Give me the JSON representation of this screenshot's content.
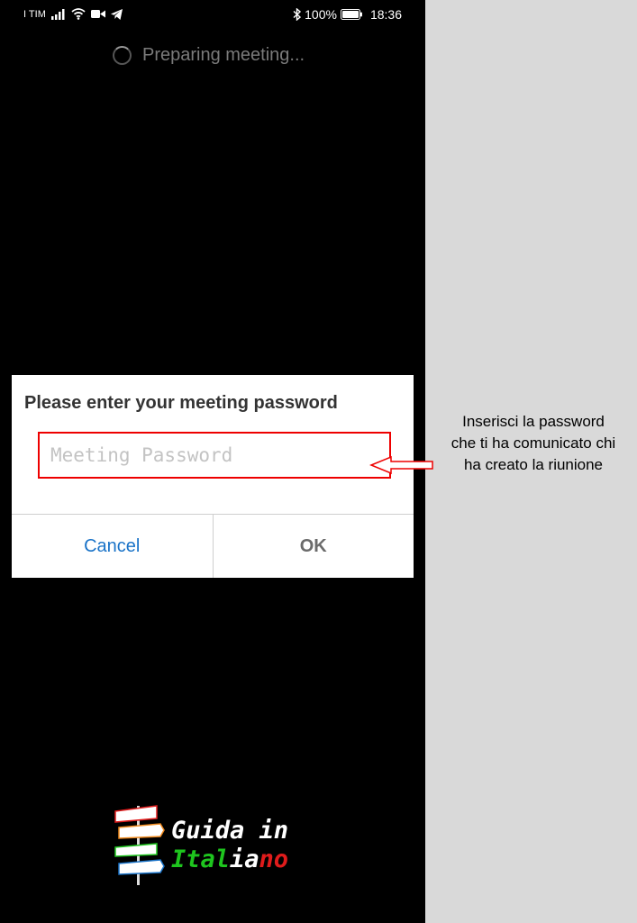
{
  "status_bar": {
    "carrier": "I TIM",
    "battery": "100%",
    "time": "18:36"
  },
  "loading": {
    "text": "Preparing meeting..."
  },
  "dialog": {
    "title": "Please enter your meeting password",
    "password_placeholder": "Meeting Password",
    "cancel_label": "Cancel",
    "ok_label": "OK"
  },
  "annotation": {
    "line1": "Inserisci la password",
    "line2": "che ti ha comunicato chi",
    "line3": "ha creato la riunione"
  },
  "logo": {
    "line1": "Guida in",
    "line2_part1": "Ital",
    "line2_part2": "ia",
    "line2_part3": "no"
  },
  "colors": {
    "cancel": "#1a73c8",
    "highlight": "#e00000",
    "logo_green": "#1ec51e",
    "logo_red": "#e01b1b"
  }
}
